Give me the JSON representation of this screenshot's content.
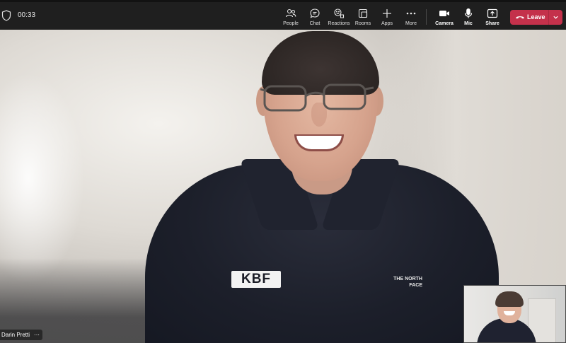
{
  "meeting": {
    "timer": "00:33"
  },
  "toolbar": {
    "people_label": "People",
    "chat_label": "Chat",
    "reactions_label": "Reactions",
    "rooms_label": "Rooms",
    "apps_label": "Apps",
    "more_label": "More",
    "camera_label": "Camera",
    "mic_label": "Mic",
    "share_label": "Share",
    "leave_label": "Leave"
  },
  "participant": {
    "name": "Darin Pretti",
    "options_label": "⋯"
  },
  "shirt": {
    "logo_text": "KBF",
    "brand_text": "THE NORTH FACE"
  },
  "colors": {
    "leave_red": "#c4314b",
    "toolbar_bg": "#1f1f1f"
  }
}
